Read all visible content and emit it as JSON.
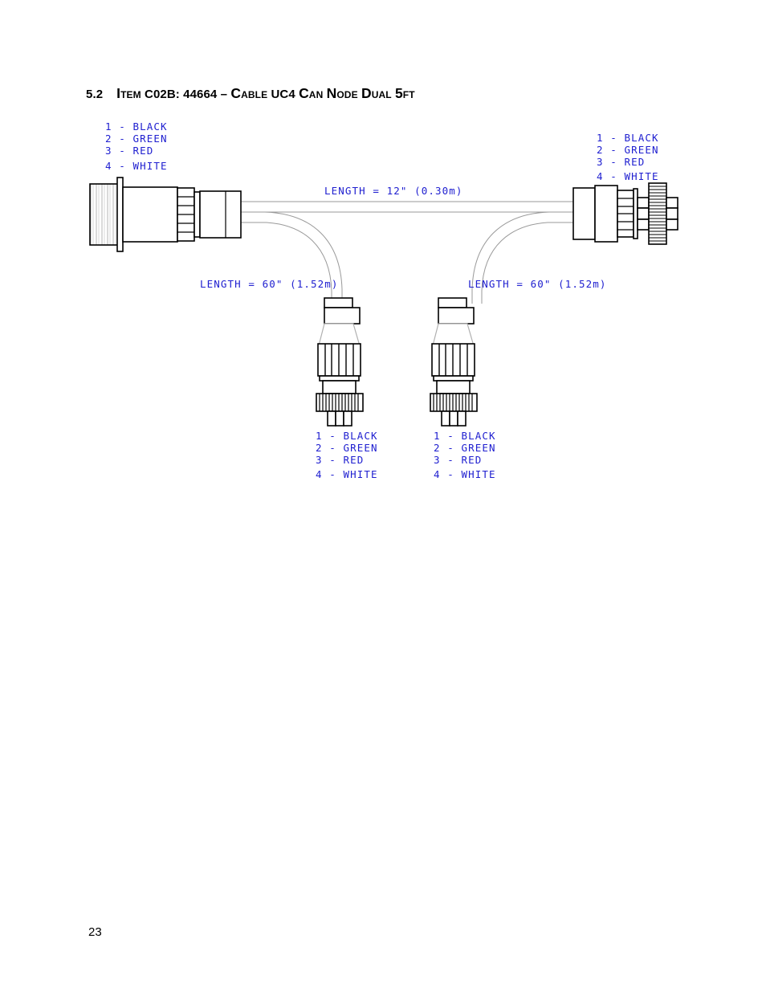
{
  "document": {
    "page_number": "23"
  },
  "heading": {
    "number": "5.2",
    "title_parts": {
      "item": "Item",
      "code": "C02B: 44664",
      "dash": "–",
      "name": "Cable",
      "uc4": "UC4",
      "can": "Can",
      "node": "Node",
      "dual": "Dual",
      "length": "5ft"
    },
    "full_title": "5.2   Item C02B: 44664 – Cable UC4 Can Node Dual 5ft"
  },
  "diagram": {
    "title": "Cable UC4 Can Node Dual 5ft wiring diagram",
    "line_color": "#000000",
    "cable_color": "#9a9a9a",
    "text_color": "#2020d0",
    "pinouts": [
      {
        "id": "left-main-connector",
        "lines": [
          "1 - BLACK",
          "2 - GREEN",
          "3 - RED",
          "4 - WHITE"
        ]
      },
      {
        "id": "right-main-connector",
        "lines": [
          "1 - BLACK",
          "2 - GREEN",
          "3 - RED",
          "4 - WHITE"
        ]
      },
      {
        "id": "left-drop-connector",
        "lines": [
          "1 - BLACK",
          "2 - GREEN",
          "3 - RED",
          "4 - WHITE"
        ]
      },
      {
        "id": "right-drop-connector",
        "lines": [
          "1 - BLACK",
          "2 - GREEN",
          "3 - RED",
          "4 - WHITE"
        ]
      }
    ],
    "length_labels": [
      {
        "id": "trunk",
        "text": "LENGTH = 12\" (0.30m)"
      },
      {
        "id": "left-branch",
        "text": "LENGTH = 60\" (1.52m)"
      },
      {
        "id": "right-branch",
        "text": "LENGTH = 60\" (1.52m)"
      }
    ]
  }
}
